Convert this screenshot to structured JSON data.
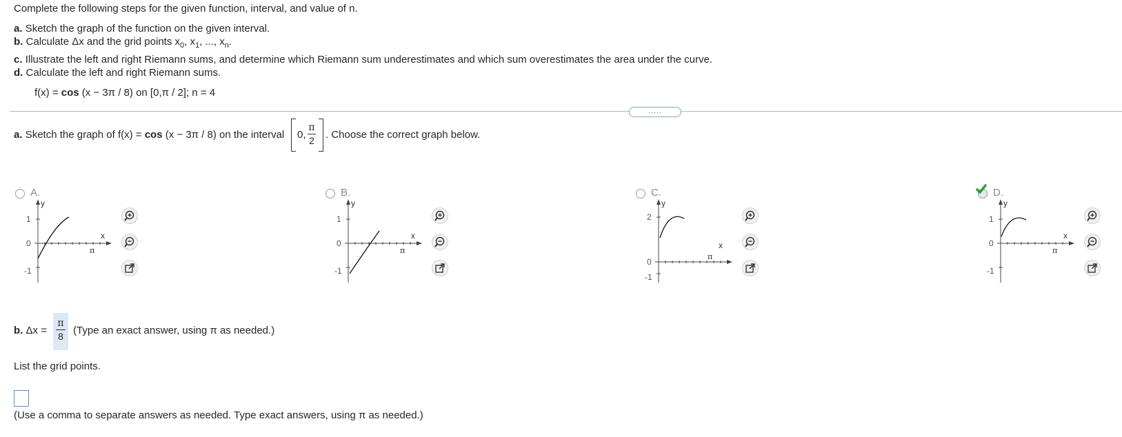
{
  "instructions": {
    "intro": "Complete the following steps for the given function, interval, and value of n.",
    "a_label": "a.",
    "a_text": "Sketch the graph of the function on the given interval.",
    "b_label": "b.",
    "b_text_pre": "Calculate Δx and the grid points x",
    "b_sub0": "0",
    "b_sep1": ", x",
    "b_sub1": "1",
    "b_sep2": ", ..., x",
    "b_subn": "n",
    "b_end": ".",
    "c_label": "c.",
    "c_text": "Illustrate the left and right Riemann sums, and determine which Riemann sum underestimates and which sum overestimates the area under the curve.",
    "d_label": "d.",
    "d_text": "Calculate the left and right Riemann sums.",
    "function_pre": "f(x) = ",
    "function_cos": "cos",
    "function_post": " (x − 3π / 8) on [0,π / 2]; n = 4"
  },
  "more_button": ".....",
  "part_a": {
    "label": "a.",
    "text_pre": "Sketch the graph of f(x) = ",
    "cos": "cos",
    "text_mid": " (x − 3π / 8) on the interval",
    "interval_left": "0,",
    "interval_num": "π",
    "interval_den": "2",
    "text_post": ". Choose the correct graph below."
  },
  "options": [
    {
      "letter": "A.",
      "selected": false,
      "y_top": "1",
      "y_zero": "0",
      "y_bottom": "-1",
      "x_label": "x",
      "y_label": "y",
      "pi_label": "π"
    },
    {
      "letter": "B.",
      "selected": false,
      "y_top": "1",
      "y_zero": "0",
      "y_bottom": "-1",
      "x_label": "x",
      "y_label": "y",
      "pi_label": "π"
    },
    {
      "letter": "C.",
      "selected": false,
      "y_top": "2",
      "y_zero": "0",
      "y_bottom": "-1",
      "x_label": "x",
      "y_label": "y",
      "pi_label": "π"
    },
    {
      "letter": "D.",
      "selected": true,
      "y_top": "1",
      "y_zero": "0",
      "y_bottom": "-1",
      "x_label": "x",
      "y_label": "y",
      "pi_label": "π"
    }
  ],
  "icons": {
    "zoom_in": "zoom-in-icon",
    "zoom_out": "zoom-out-icon",
    "open_window": "open-window-icon",
    "check": "check-icon"
  },
  "colors": {
    "check": "#2e9e36",
    "input_border": "#4a90d9",
    "answer_bg": "#dce8f5"
  },
  "part_b": {
    "label": "b.",
    "dx_text": " Δx =",
    "answer_num": "π",
    "answer_den": "8",
    "hint": "(Type an exact answer, using π as needed.)",
    "list_prompt": "List the grid points.",
    "grid_points_value": "",
    "list_hint": "(Use a comma to separate answers as needed. Type exact answers, using π as needed.)"
  }
}
